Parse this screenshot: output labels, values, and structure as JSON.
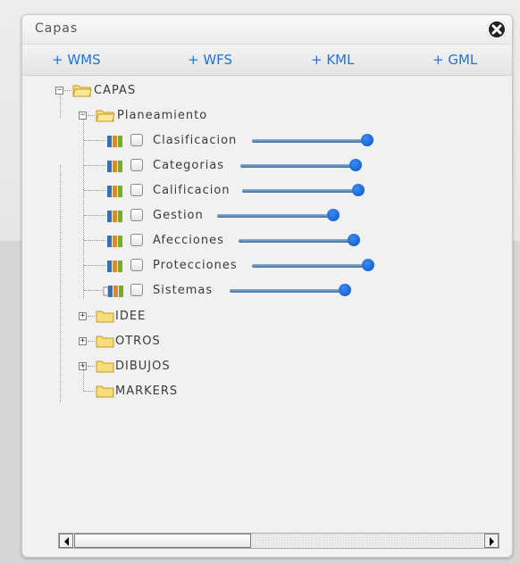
{
  "panel": {
    "title": "Capas",
    "close_icon": "close-circle-icon"
  },
  "toolbar": {
    "wms_label": "+ WMS",
    "wfs_label": "+ WFS",
    "kml_label": "+ KML",
    "gml_label": "+ GML"
  },
  "tree": {
    "root": {
      "label": "CAPAS",
      "expanded": true
    },
    "planeamiento": {
      "label": "Planeamiento",
      "expanded": true
    },
    "layers": [
      {
        "label": "Clasificacion",
        "checked": false,
        "opacity": 1.0
      },
      {
        "label": "Categorias",
        "checked": false,
        "opacity": 1.0
      },
      {
        "label": "Calificacion",
        "checked": false,
        "opacity": 1.0
      },
      {
        "label": "Gestion",
        "checked": false,
        "opacity": 1.0
      },
      {
        "label": "Afecciones",
        "checked": false,
        "opacity": 1.0
      },
      {
        "label": "Protecciones",
        "checked": false,
        "opacity": 1.0
      },
      {
        "label": "Sistemas",
        "checked": false,
        "opacity": 1.0
      }
    ],
    "folders": [
      {
        "label": "IDEE",
        "expanded": false
      },
      {
        "label": "OTROS",
        "expanded": false
      },
      {
        "label": "DIBUJOS",
        "expanded": false
      },
      {
        "label": "MARKERS",
        "expanded": false
      }
    ]
  },
  "colors": {
    "accent": "#1f73d8",
    "slider_knob": "#0a54c8",
    "folder_fill": "#f7dc7a",
    "folder_stroke": "#c89a1c"
  },
  "scrollbar": {
    "position": 0.0
  }
}
